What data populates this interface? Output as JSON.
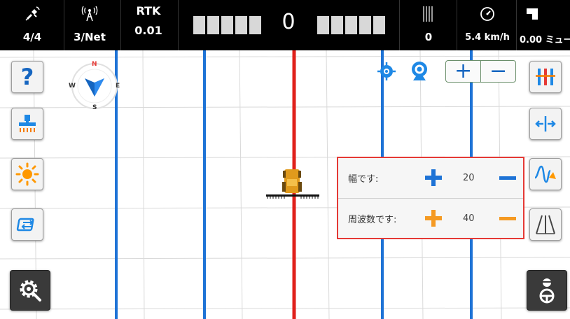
{
  "status_bar": {
    "satellites": {
      "icon": "satellite-icon",
      "value": "4/4"
    },
    "network": {
      "icon": "antenna-icon",
      "value": "3/Net"
    },
    "rtk": {
      "label": "RTK",
      "value": "0.01"
    },
    "offset_value": "0",
    "line_count": {
      "icon": "line-bars-icon",
      "value": "0"
    },
    "speed": {
      "icon": "speedometer-icon",
      "value": "5.4 km/h"
    },
    "area": {
      "icon": "area-square-icon",
      "value": "0.00 ミュー"
    }
  },
  "panel": {
    "width": {
      "label": "幅です:",
      "value": "20"
    },
    "frequency": {
      "label": "周波数です:",
      "value": "40"
    }
  },
  "compass": {
    "n": "N",
    "s": "S",
    "e": "E",
    "w": "W"
  },
  "zoom": {
    "in": "+",
    "out": "−"
  },
  "colors": {
    "guide_blue": "#1e73d6",
    "guide_red": "#e0201b",
    "panel_border": "#e53935",
    "plus_blue": "#1e73d6",
    "plus_orange": "#f59a23"
  }
}
